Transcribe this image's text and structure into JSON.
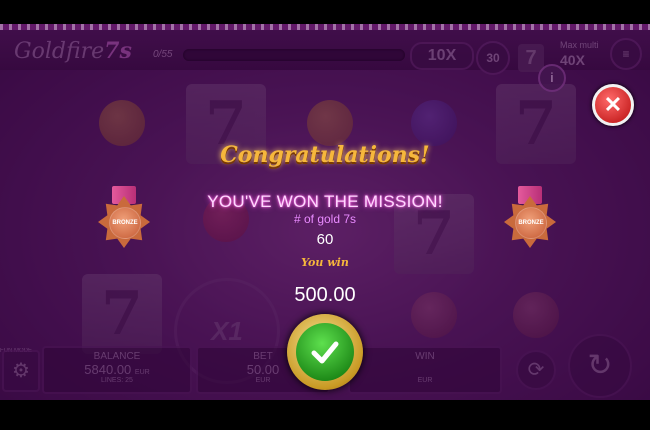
{
  "game": {
    "logo": "Goldfire",
    "logo_accent": "7s",
    "progress_label": "0/55",
    "bet_multiplier": "10X",
    "spins_left": "30",
    "mini_symbol": "7",
    "max_multiplier_label": "Max multi",
    "max_multiplier_value": "40X",
    "wheel_label": "X1"
  },
  "dialog": {
    "title": "Congratulations!",
    "headline": "YOU'VE WON THE MISSION!",
    "goal_label": "# of gold 7s",
    "goal_value": "60",
    "you_win_label": "You win",
    "win_amount": "500.00",
    "medal_label": "BRONZE",
    "close_icon": "close-icon",
    "confirm_icon": "checkmark-icon"
  },
  "footer": {
    "mode_label": "FUN MODE",
    "balance_label": "BALANCE",
    "balance_value": "5840.00",
    "balance_currency": "EUR",
    "lines_label": "LINES: 25",
    "bet_label": "BET",
    "bet_value": "50.00",
    "bet_currency": "EUR",
    "win_label": "WIN",
    "win_currency": "EUR"
  },
  "colors": {
    "gold": "#f6b73c",
    "pink_glow": "#ff4fe0",
    "close_red": "#d01818",
    "confirm_green": "#2ea82a",
    "bronze": "#c96a3c"
  }
}
